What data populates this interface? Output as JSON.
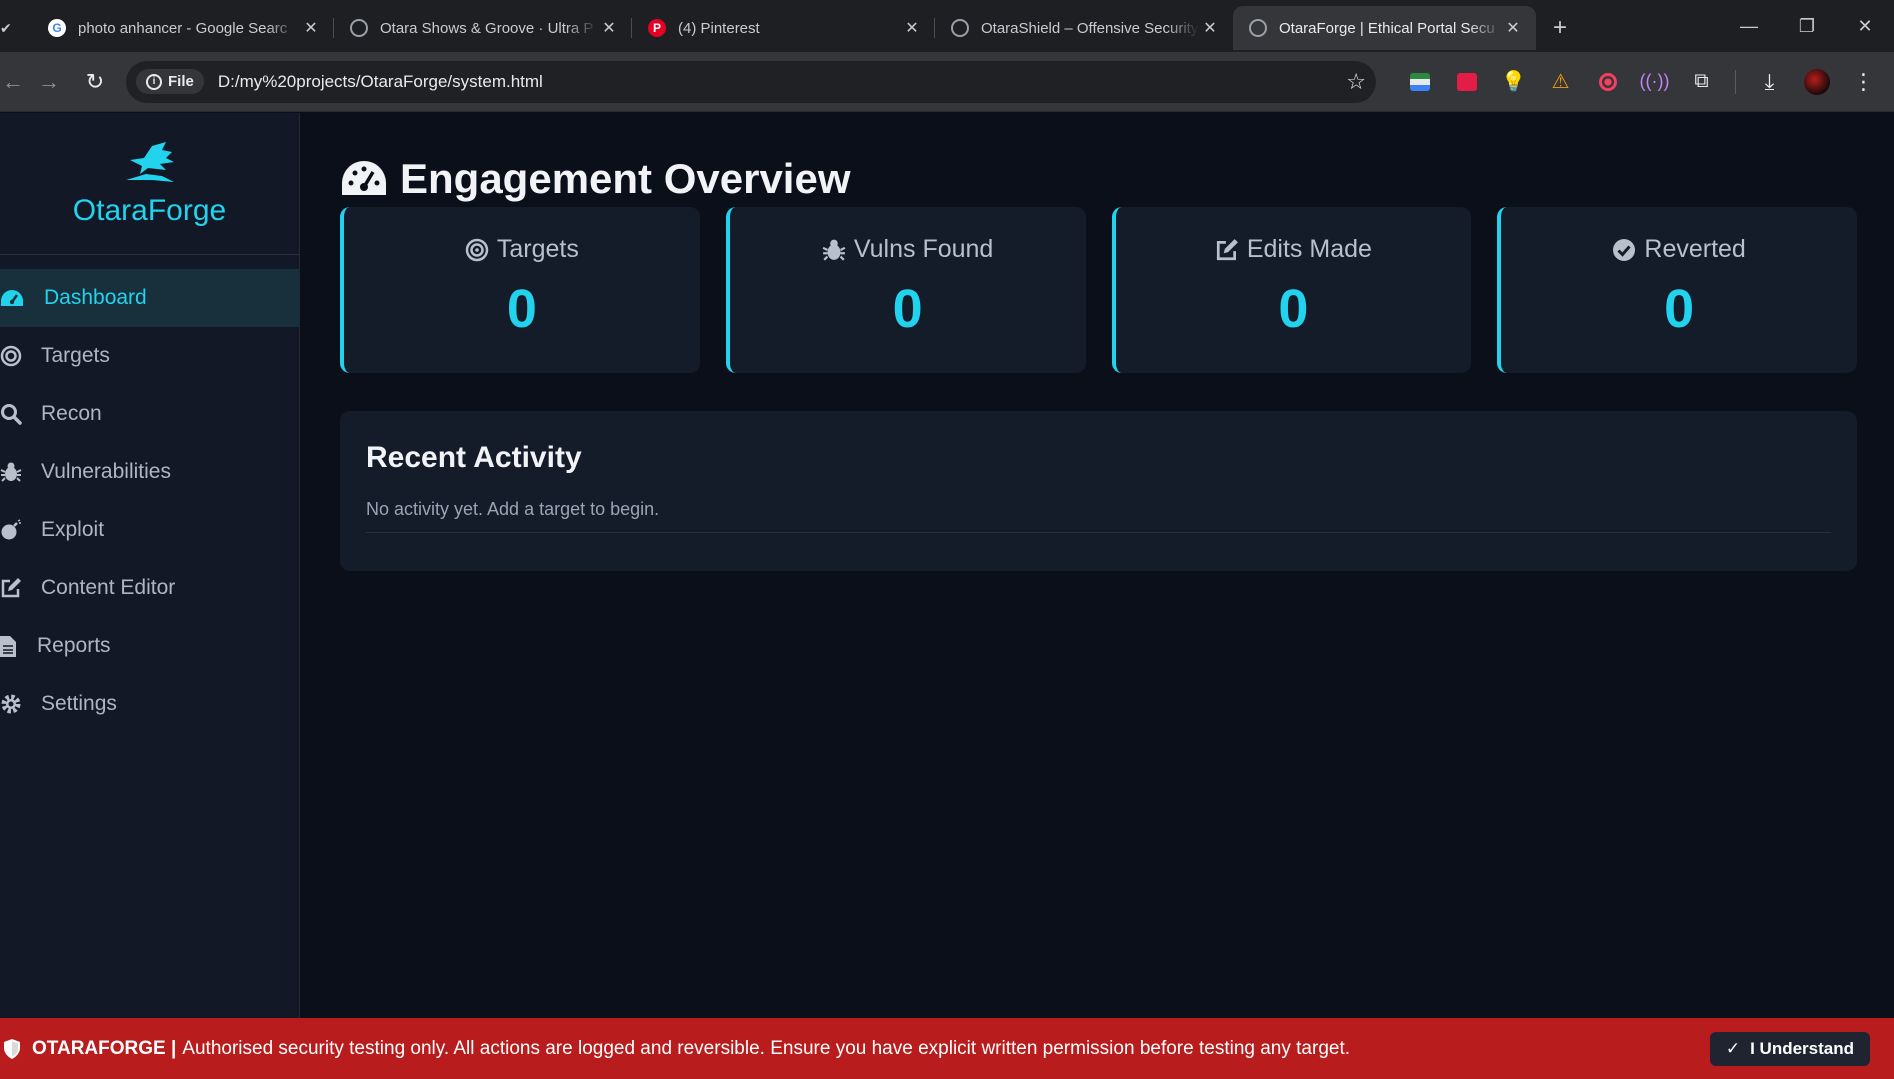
{
  "browser": {
    "tabs": [
      {
        "title": "photo anhancer - Google Searc",
        "favicon": "google-icon",
        "active": false
      },
      {
        "title": "Otara Shows & Groove · Ultra P",
        "favicon": "globe-icon",
        "active": false
      },
      {
        "title": "(4) Pinterest",
        "favicon": "pinterest-icon",
        "active": false
      },
      {
        "title": "OtaraShield – Offensive Security",
        "favicon": "globe-icon",
        "active": false
      },
      {
        "title": "OtaraForge | Ethical Portal Secu",
        "favicon": "globe-icon",
        "active": true
      }
    ],
    "scheme_chip": "File",
    "url": "D:/my%20projects/OtaraForge/system.html"
  },
  "sidebar": {
    "brand": "OtaraForge",
    "items": [
      {
        "label": "Dashboard",
        "icon": "gauge-icon",
        "active": true
      },
      {
        "label": "Targets",
        "icon": "target-icon",
        "active": false
      },
      {
        "label": "Recon",
        "icon": "search-icon",
        "active": false
      },
      {
        "label": "Vulnerabilities",
        "icon": "bug-icon",
        "active": false
      },
      {
        "label": "Exploit",
        "icon": "bomb-icon",
        "active": false
      },
      {
        "label": "Content Editor",
        "icon": "edit-icon",
        "active": false
      },
      {
        "label": "Reports",
        "icon": "file-icon",
        "active": false
      },
      {
        "label": "Settings",
        "icon": "gear-icon",
        "active": false
      }
    ]
  },
  "main": {
    "title": "Engagement Overview",
    "stats": [
      {
        "label": "Targets",
        "value": "0",
        "icon": "target-icon"
      },
      {
        "label": "Vulns Found",
        "value": "0",
        "icon": "bug-icon"
      },
      {
        "label": "Edits Made",
        "value": "0",
        "icon": "edit-icon"
      },
      {
        "label": "Reverted",
        "value": "0",
        "icon": "check-circle-icon"
      }
    ],
    "recent": {
      "title": "Recent Activity",
      "empty": "No activity yet. Add a target to begin."
    }
  },
  "banner": {
    "brand": "OTARAFORGE |",
    "message": "Authorised security testing only. All actions are logged and reversible. Ensure you have explicit written permission before testing any target.",
    "button": "I Understand"
  },
  "colors": {
    "accent": "#22d3ee",
    "background": "#0b0f19",
    "panel": "#141b29",
    "banner": "#b91c1c"
  }
}
